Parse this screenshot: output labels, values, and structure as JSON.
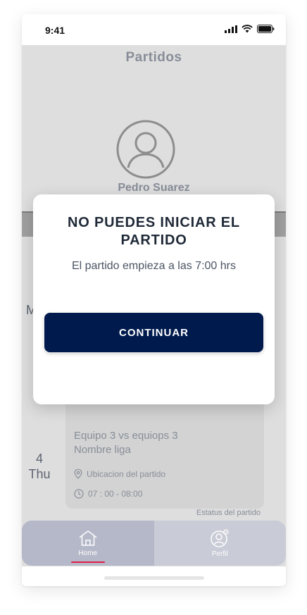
{
  "status_bar": {
    "time": "9:41"
  },
  "screen": {
    "title": "Partidos",
    "profile_name": "Pedro Suarez",
    "partial_day_letter": "M",
    "match": {
      "day_number": "4",
      "day_name": "Thu",
      "teams": "Equipo 3 vs equiops 3",
      "league": "Nombre liga",
      "location": "Ubicacion del partido",
      "time": "07 : 00 - 08:00",
      "status": "Estatus del partido"
    }
  },
  "modal": {
    "title": "NO PUEDES INICIAR EL PARTIDO",
    "message": "El partido empieza a las 7:00 hrs",
    "button_label": "CONTINUAR"
  },
  "tabbar": {
    "tabs": [
      {
        "label": "Home",
        "icon": "home-icon",
        "active": true
      },
      {
        "label": "Perfil",
        "icon": "profile-settings-icon",
        "active": false
      }
    ]
  },
  "colors": {
    "primary_button": "#001a4d",
    "active_tab_indicator": "#e11d48"
  }
}
